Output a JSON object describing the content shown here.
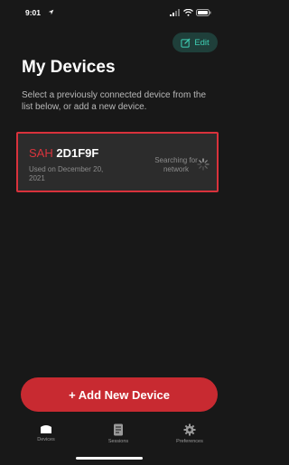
{
  "status_bar": {
    "time": "9:01"
  },
  "header": {
    "edit_label": "Edit",
    "title": "My Devices",
    "subtitle": "Select a previously connected device from the list below, or add a new device."
  },
  "device": {
    "prefix": "SAH",
    "id": "2D1F9F",
    "used_on": "Used on December 20, 2021",
    "status": "Searching for network"
  },
  "actions": {
    "add_device_label": "+ Add New Device"
  },
  "tabs": [
    {
      "label": "Devices",
      "icon": "device-icon"
    },
    {
      "label": "Sessions",
      "icon": "document-icon"
    },
    {
      "label": "Preferences",
      "icon": "gear-icon"
    }
  ],
  "colors": {
    "accent_red": "#c82a31",
    "accent_teal": "#3fd0b5",
    "background": "#181818",
    "card": "#2c2c2c"
  }
}
